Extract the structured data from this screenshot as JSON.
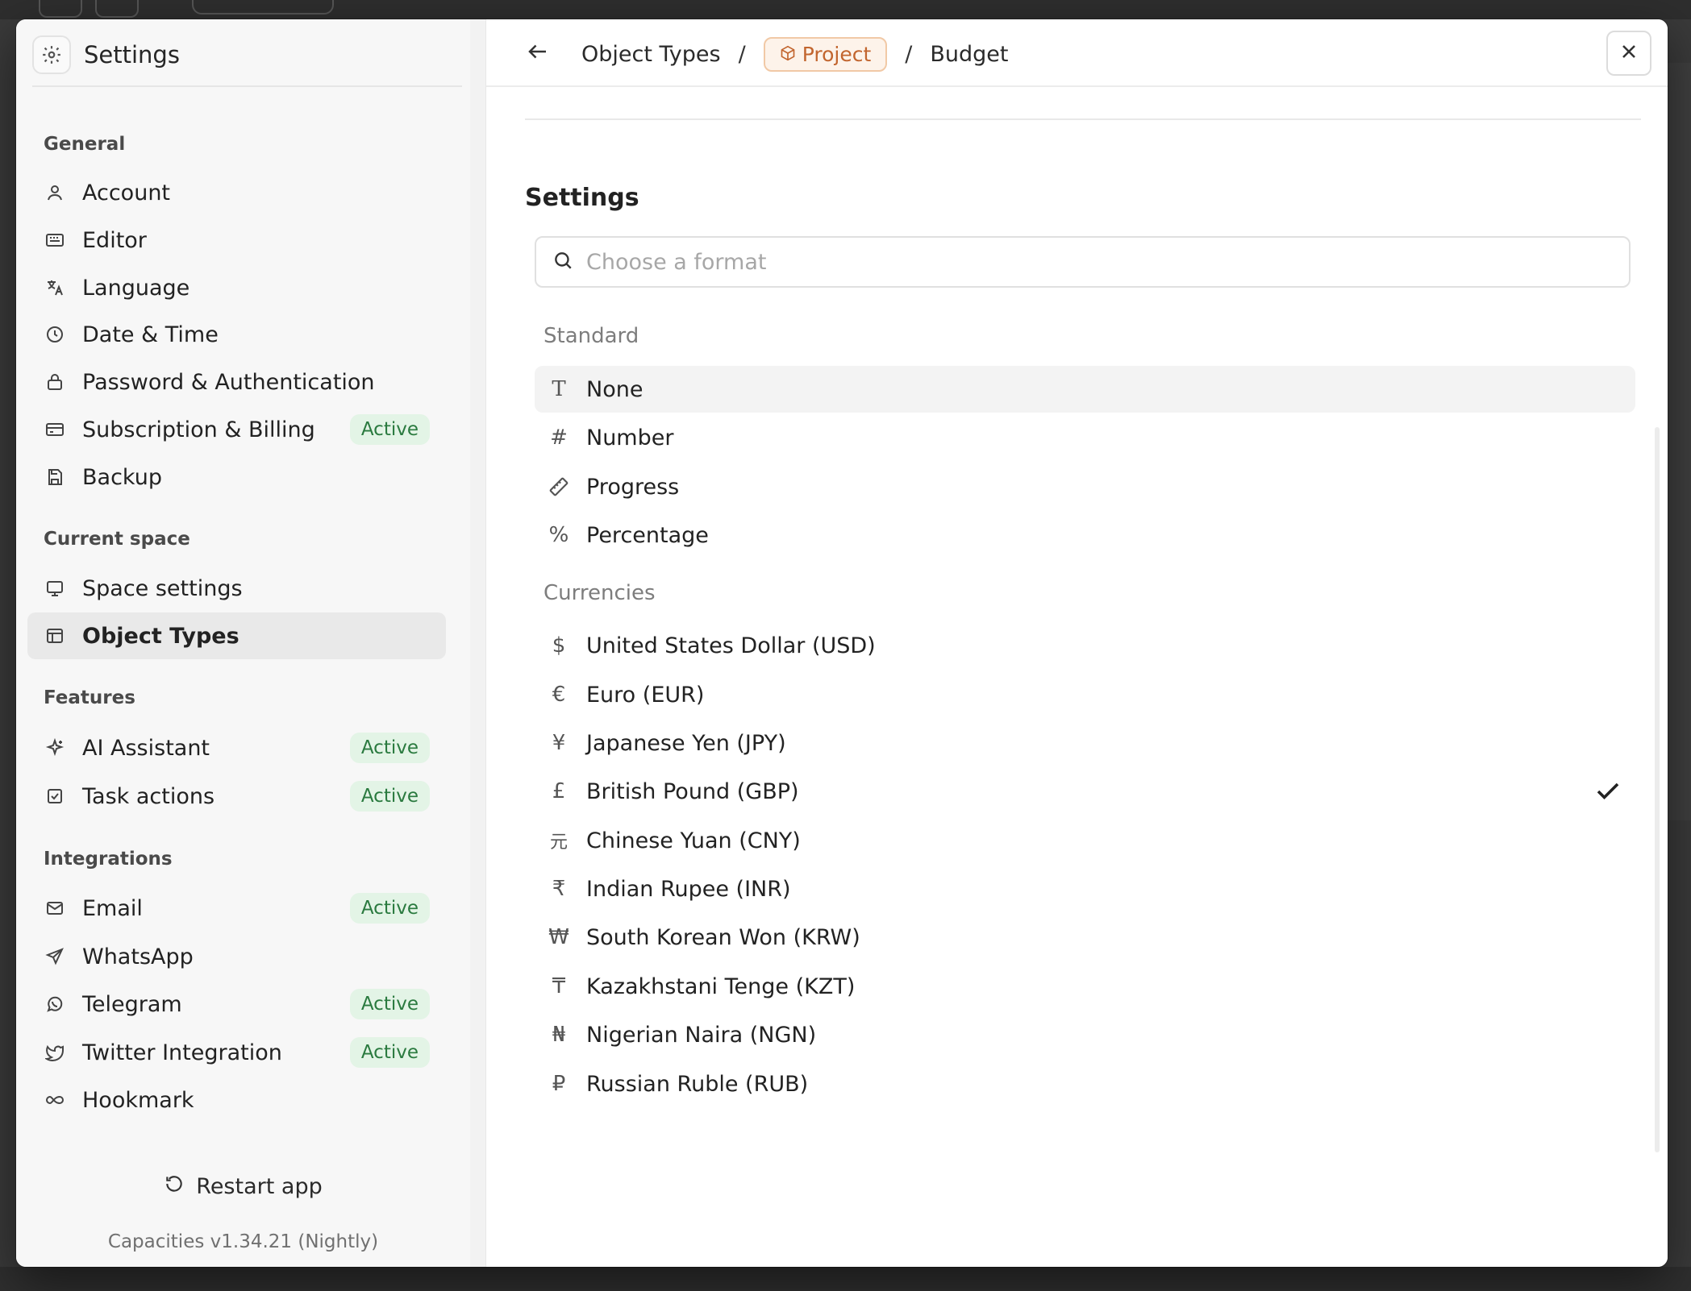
{
  "sidebar": {
    "title": "Settings",
    "sections": {
      "general": "General",
      "current_space": "Current space",
      "features": "Features",
      "integrations": "Integrations"
    },
    "items": [
      {
        "label": "Account"
      },
      {
        "label": "Editor"
      },
      {
        "label": "Language"
      },
      {
        "label": "Date & Time"
      },
      {
        "label": "Password & Authentication"
      },
      {
        "label": "Subscription & Billing",
        "badge": "Active"
      },
      {
        "label": "Backup"
      },
      {
        "label": "Space settings"
      },
      {
        "label": "Object Types",
        "selected": true
      },
      {
        "label": "AI Assistant",
        "badge": "Active"
      },
      {
        "label": "Task actions",
        "badge": "Active"
      },
      {
        "label": "Email",
        "badge": "Active"
      },
      {
        "label": "WhatsApp"
      },
      {
        "label": "Telegram",
        "badge": "Active"
      },
      {
        "label": "Twitter Integration",
        "badge": "Active"
      },
      {
        "label": "Hookmark"
      }
    ],
    "restart_label": "Restart app",
    "version": "Capacities v1.34.21 (Nightly)"
  },
  "header": {
    "breadcrumb": {
      "root": "Object Types",
      "separator": "/",
      "pill": "Project",
      "current": "Budget"
    }
  },
  "content": {
    "title": "Settings",
    "search": {
      "placeholder": "Choose a format",
      "value": ""
    },
    "standard_label": "Standard",
    "standard": [
      {
        "icon": "T",
        "label": "None"
      },
      {
        "icon": "#",
        "label": "Number"
      },
      {
        "icon": "ruler-icon",
        "label": "Progress"
      },
      {
        "icon": "%",
        "label": "Percentage"
      }
    ],
    "currencies_label": "Currencies",
    "currencies": [
      {
        "icon": "$",
        "label": "United States Dollar (USD)"
      },
      {
        "icon": "€",
        "label": "Euro (EUR)"
      },
      {
        "icon": "¥",
        "label": "Japanese Yen (JPY)"
      },
      {
        "icon": "£",
        "label": "British Pound (GBP)",
        "selected": true
      },
      {
        "icon": "元",
        "label": "Chinese Yuan (CNY)"
      },
      {
        "icon": "₹",
        "label": "Indian Rupee (INR)"
      },
      {
        "icon": "₩",
        "label": "South Korean Won (KRW)"
      },
      {
        "icon": "₸",
        "label": "Kazakhstani Tenge (KZT)"
      },
      {
        "icon": "₦",
        "label": "Nigerian Naira (NGN)"
      },
      {
        "icon": "₽",
        "label": "Russian Ruble (RUB)"
      }
    ]
  },
  "colors": {
    "accent_pill_bg": "#fdf3ea",
    "accent_pill_text": "#c2652e",
    "badge_bg": "#e3f4e6",
    "badge_text": "#2a7a3f"
  }
}
